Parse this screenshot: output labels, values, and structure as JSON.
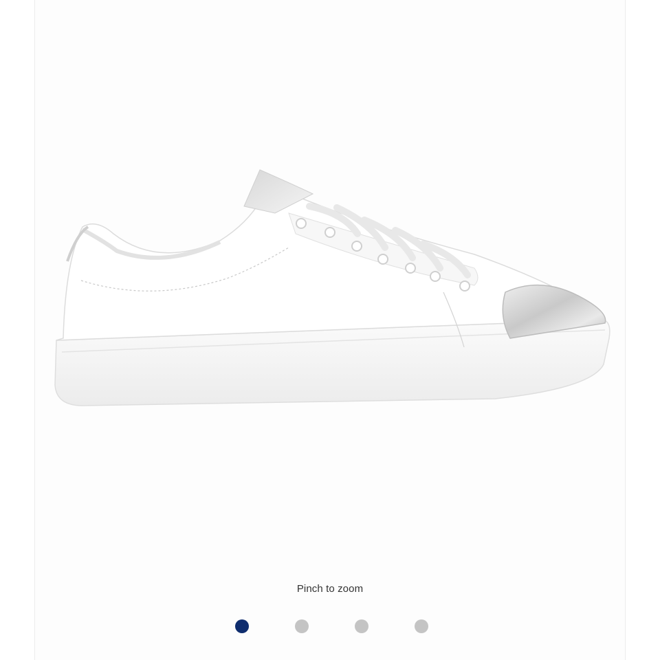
{
  "gallery": {
    "zoom_hint": "Pinch to zoom",
    "active_index": 0,
    "slide_count": 4,
    "colors": {
      "active_dot": "#0f2d6e",
      "inactive_dot": "#c4c4c4"
    }
  }
}
